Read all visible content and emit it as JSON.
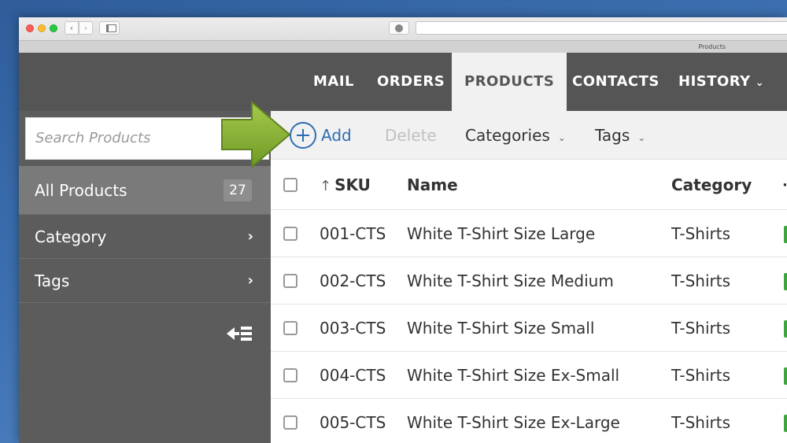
{
  "browser": {
    "tab_title": "Products"
  },
  "nav": {
    "tabs": [
      {
        "label": "MAIL"
      },
      {
        "label": "ORDERS"
      },
      {
        "label": "PRODUCTS"
      },
      {
        "label": "CONTACTS"
      },
      {
        "label": "HISTORY"
      }
    ]
  },
  "sidebar": {
    "search_placeholder": "Search Products",
    "items": [
      {
        "label": "All Products",
        "count": "27"
      },
      {
        "label": "Category"
      },
      {
        "label": "Tags"
      }
    ]
  },
  "toolbar": {
    "add_label": "Add",
    "delete_label": "Delete",
    "categories_label": "Categories",
    "tags_label": "Tags"
  },
  "table": {
    "columns": {
      "sku": "SKU",
      "name": "Name",
      "category": "Category"
    },
    "rows": [
      {
        "sku": "001-CTS",
        "name": "White T-Shirt Size Large",
        "category": "T-Shirts"
      },
      {
        "sku": "002-CTS",
        "name": "White T-Shirt Size Medium",
        "category": "T-Shirts"
      },
      {
        "sku": "003-CTS",
        "name": "White T-Shirt Size Small",
        "category": "T-Shirts"
      },
      {
        "sku": "004-CTS",
        "name": "White T-Shirt Size Ex-Small",
        "category": "T-Shirts"
      },
      {
        "sku": "005-CTS",
        "name": "White T-Shirt Size Ex-Large",
        "category": "T-Shirts"
      }
    ]
  },
  "colors": {
    "accent": "#2d6db3",
    "nav_bg": "#555555",
    "sidebar_bg": "#5c5c5c",
    "arrow": "#8db23a",
    "status": "#3ea53e"
  },
  "icons": {
    "add": "plus-circle-icon",
    "dropdown": "chevron-down-icon",
    "collapse": "collapse-sidebar-icon",
    "sort": "sort-up-icon",
    "pointer": "arrow-right-icon"
  }
}
